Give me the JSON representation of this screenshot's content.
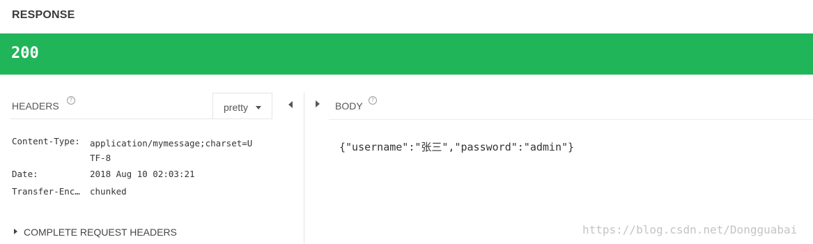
{
  "response": {
    "title": "RESPONSE",
    "status_code": "200",
    "status_color": "#21b55a"
  },
  "headers_pane": {
    "label": "HEADERS",
    "help_icon": "question-circle-icon",
    "format_select": {
      "selected": "pretty"
    },
    "rows": [
      {
        "key": "Content-Type:",
        "value": "application/mymessage;charset=U\nTF-8"
      },
      {
        "key": "Date:",
        "value": "2018 Aug 10 02:03:21"
      },
      {
        "key": "Transfer-Enc…",
        "value": "chunked"
      }
    ],
    "complete_request_headers_label": "COMPLETE REQUEST HEADERS"
  },
  "body_pane": {
    "label": "BODY",
    "help_icon": "question-circle-icon",
    "content": "{\"username\":\"张三\",\"password\":\"admin\"}"
  },
  "watermark": "https://blog.csdn.net/Dongguabai"
}
